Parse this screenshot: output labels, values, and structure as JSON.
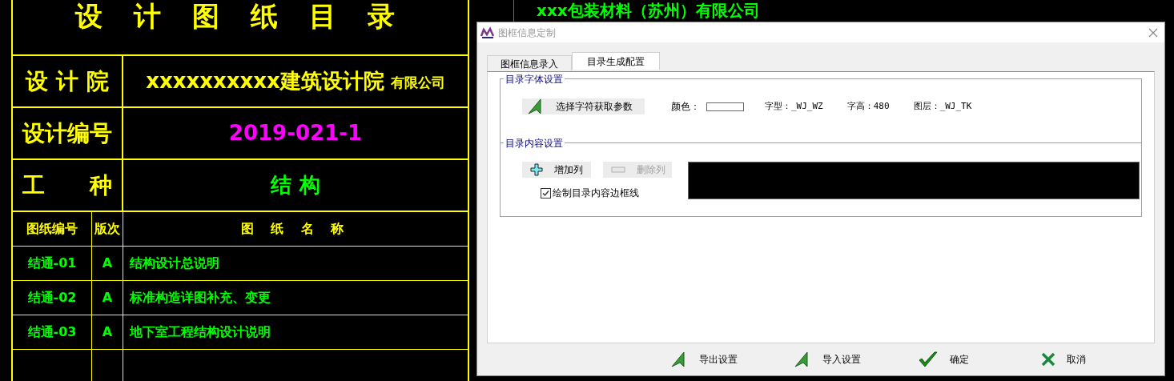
{
  "drawing": {
    "title": "设 计 图 纸 目 录",
    "company": "xxx包装材料（苏州）有限公司",
    "info_rows": [
      {
        "label": "设 计 院",
        "value": "xxxxxxxxxx建筑设计院",
        "suffix": "有限公司",
        "color": "#ffff00"
      },
      {
        "label": "设计编号",
        "value": "2019-021-1",
        "color": "#ff00ff"
      },
      {
        "label": "工　　种",
        "value": "结 构",
        "color": "#00ff00"
      }
    ],
    "table": {
      "columns": [
        "图纸编号",
        "版次",
        "图 纸 名 称"
      ],
      "rows": [
        {
          "number": "结通-01",
          "version": "A",
          "name": "结构设计总说明"
        },
        {
          "number": "结通-02",
          "version": "A",
          "name": "标准构造详图补充、变更"
        },
        {
          "number": "结通-03",
          "version": "A",
          "name": "地下室工程结构设计说明"
        }
      ]
    }
  },
  "dialog": {
    "title": "图框信息定制",
    "tabs": [
      {
        "label": "图框信息录入",
        "selected": false
      },
      {
        "label": "目录生成配置",
        "selected": true
      }
    ],
    "font_group": {
      "title": "目录字体设置",
      "pick_button": "选择字符获取参数",
      "color_label": "颜色：",
      "style": "字型：_WJ_WZ",
      "height": "字高：480",
      "layer": "图层：_WJ_TK"
    },
    "content_group": {
      "title": "目录内容设置",
      "buttons": [
        {
          "label": "增加列",
          "kind": "add",
          "disabled": false
        },
        {
          "label": "删除列",
          "kind": "remove",
          "disabled": true
        }
      ],
      "checkbox": {
        "label": "绘制目录内容边框线",
        "checked": true
      }
    },
    "footer_buttons": [
      {
        "label": "导出设置",
        "kind": "export"
      },
      {
        "label": "导入设置",
        "kind": "import"
      },
      {
        "label": "确定",
        "kind": "ok"
      },
      {
        "label": "取消",
        "kind": "cancel"
      }
    ]
  }
}
